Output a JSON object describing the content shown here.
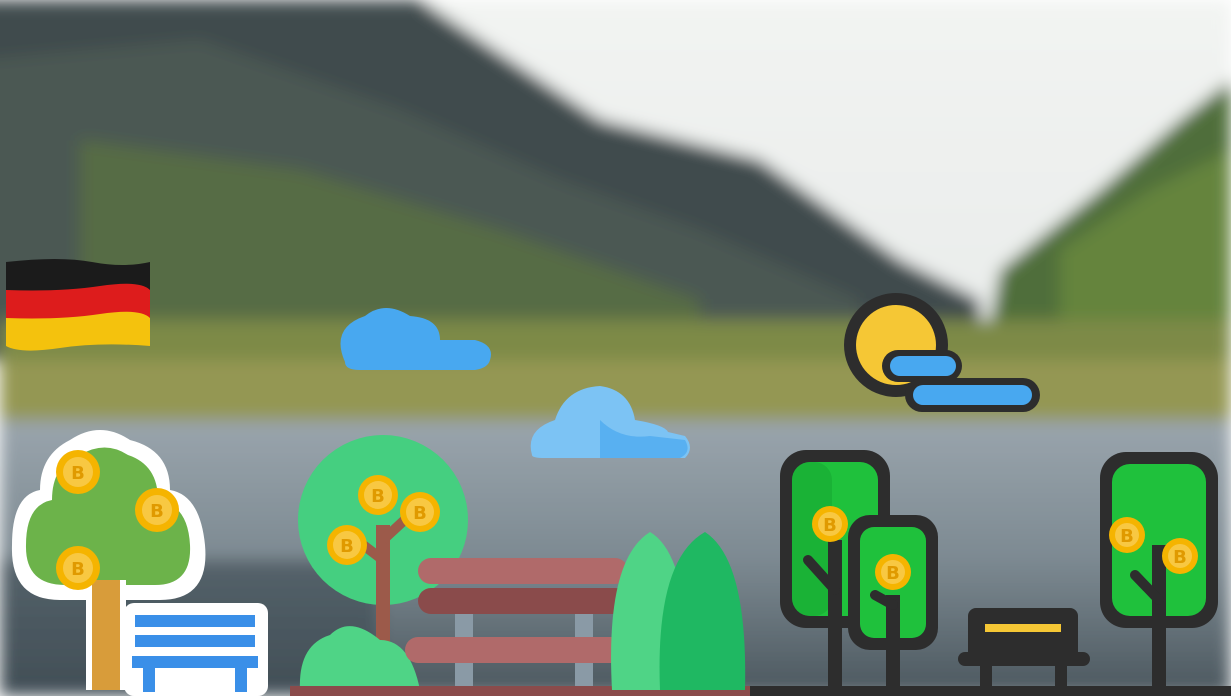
{
  "scene": {
    "description_tags": [
      "landscape-photo-background",
      "bitcoin-money-trees",
      "park-benches",
      "clouds",
      "sun",
      "flag"
    ],
    "flag": {
      "country": "Germany",
      "colors": [
        "#1b1b1b",
        "#dd1c1c",
        "#f4c20d"
      ]
    },
    "coin_symbol": "B",
    "colors": {
      "sky": "#e9ecea",
      "mountain_dark": "#3d4a4c",
      "mountain_green": "#5a7a3c",
      "lake": "#8e9aa3",
      "tree_green": "#6cb34a",
      "tree_light_green": "#4fd486",
      "tree_bright_green": "#1fc13c",
      "coin": "#f5b400",
      "bench_brown": "#b06a6a",
      "bench_blue": "#3a8fe8",
      "cloud_blue": "#48a8f0",
      "sun_yellow": "#f5c735",
      "outline": "#2d2d2d"
    }
  }
}
